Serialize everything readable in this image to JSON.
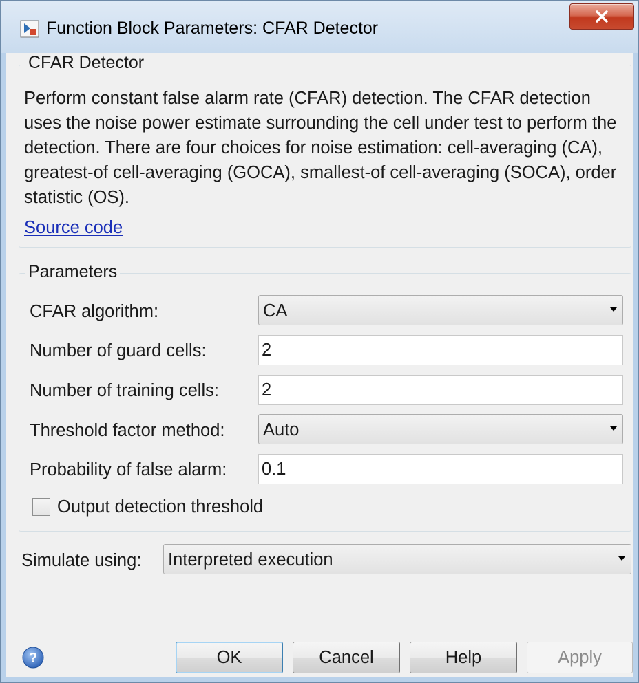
{
  "window": {
    "title": "Function Block Parameters: CFAR Detector",
    "close_label": "X"
  },
  "description_group": {
    "title": "CFAR Detector",
    "text": "Perform constant false alarm rate (CFAR) detection. The CFAR detection uses the noise power estimate surrounding the cell under test to perform the detection. There are four choices for noise estimation: cell-averaging (CA), greatest-of cell-averaging (GOCA), smallest-of cell-averaging (SOCA), order statistic (OS).",
    "link": "Source code"
  },
  "parameters": {
    "title": "Parameters",
    "cfar_algorithm": {
      "label": "CFAR algorithm:",
      "value": "CA"
    },
    "guard_cells": {
      "label": "Number of guard cells:",
      "value": "2"
    },
    "training_cells": {
      "label": "Number of training cells:",
      "value": "2"
    },
    "threshold_method": {
      "label": "Threshold factor method:",
      "value": "Auto"
    },
    "pfa": {
      "label": "Probability of false alarm:",
      "value": "0.1"
    },
    "output_threshold": {
      "label": "Output detection threshold",
      "checked": false
    }
  },
  "simulate": {
    "label": "Simulate using:",
    "value": "Interpreted execution"
  },
  "buttons": {
    "ok": "OK",
    "cancel": "Cancel",
    "help": "Help",
    "apply": "Apply"
  },
  "icons": {
    "app": "simulink-block-icon",
    "close": "close-icon",
    "help": "help-question-icon",
    "dropdown": "chevron-down-icon"
  },
  "colors": {
    "link": "#1a2fb8",
    "close_button": "#c84a2f",
    "dialog_bg": "#f0f0f0"
  }
}
